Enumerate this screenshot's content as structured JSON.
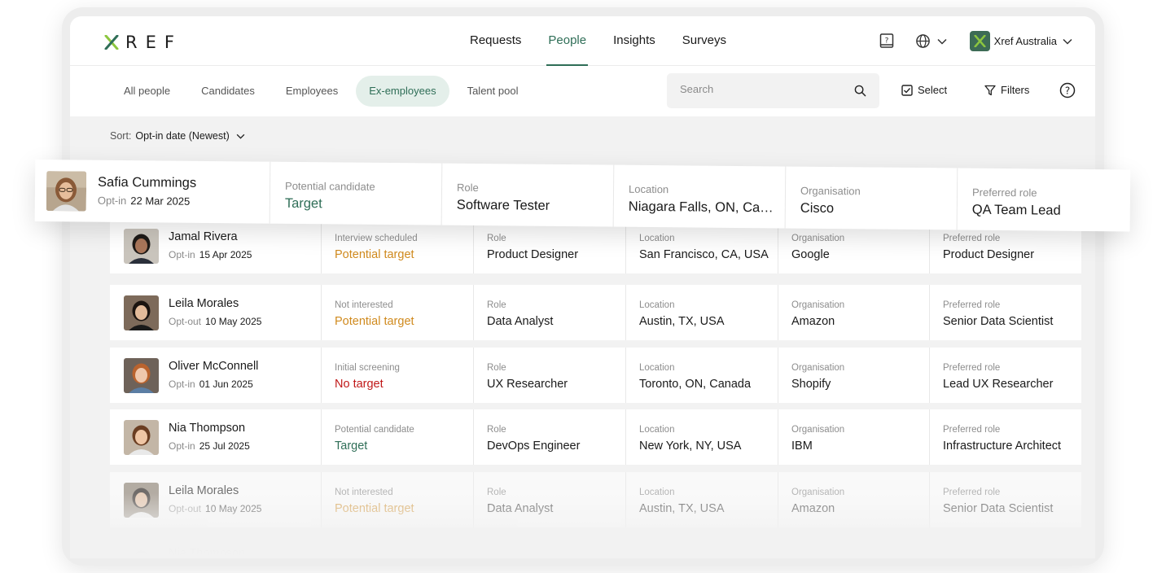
{
  "header": {
    "logo_text": "REF",
    "nav": [
      "Requests",
      "People",
      "Insights",
      "Surveys"
    ],
    "active_nav": "People",
    "org_name": "Xref Australia"
  },
  "subnav": {
    "tabs": [
      "All people",
      "Candidates",
      "Employees",
      "Ex-employees",
      "Talent pool"
    ],
    "active_tab": "Ex-employees",
    "search_placeholder": "Search",
    "select_label": "Select",
    "filters_label": "Filters"
  },
  "sort": {
    "label": "Sort:",
    "value": "Opt-in date (Newest)"
  },
  "column_titles": {
    "role": "Role",
    "location": "Location",
    "organisation": "Organisation",
    "preferred_role": "Preferred role"
  },
  "highlighted": {
    "name": "Safia Cummings",
    "opt_label": "Opt-in",
    "date": "22 Mar 2025",
    "status_title": "Potential candidate",
    "status_value": "Target",
    "role": "Software Tester",
    "location": "Niagara Falls, ON, Can...",
    "organisation": "Cisco",
    "preferred_role": "QA Team Lead"
  },
  "people": [
    {
      "name": "Jamal Rivera",
      "opt_label": "Opt-in",
      "date": "15 Apr 2025",
      "status_title": "Interview scheduled",
      "status_value": "Potential target",
      "status_color": "#d08a1e",
      "role": "Product Designer",
      "location": "San Francisco, CA, USA",
      "organisation": "Google",
      "preferred_role": "Product Designer"
    },
    {
      "name": "Leila Morales",
      "opt_label": "Opt-out",
      "date": "10 May 2025",
      "status_title": "Not interested",
      "status_value": "Potential target",
      "status_color": "#d08a1e",
      "role": "Data Analyst",
      "location": "Austin, TX, USA",
      "organisation": "Amazon",
      "preferred_role": "Senior Data Scientist"
    },
    {
      "name": "Oliver McConnell",
      "opt_label": "Opt-in",
      "date": "01 Jun 2025",
      "status_title": "Initial screening",
      "status_value": "No target",
      "status_color": "#c01818",
      "role": "UX Researcher",
      "location": "Toronto, ON, Canada",
      "organisation": "Shopify",
      "preferred_role": "Lead UX Researcher"
    },
    {
      "name": "Nia Thompson",
      "opt_label": "Opt-in",
      "date": "25 Jul 2025",
      "status_title": "Potential candidate",
      "status_value": "Target",
      "status_color": "#2f6e57",
      "role": "DevOps Engineer",
      "location": "New York, NY, USA",
      "organisation": "IBM",
      "preferred_role": "Infrastructure Architect"
    },
    {
      "name": "Leila Morales",
      "opt_label": "Opt-out",
      "date": "10 May 2025",
      "status_title": "Not interested",
      "status_value": "Potential target",
      "status_color": "#d08a1e",
      "role": "Data Analyst",
      "location": "Austin, TX, USA",
      "organisation": "Amazon",
      "preferred_role": "Senior Data Scientist"
    },
    {
      "name": "Nia Thompson",
      "opt_label": "",
      "date": "",
      "status_title": "",
      "status_value": "",
      "status_color": "#2f6e57",
      "role": "",
      "location": "",
      "organisation": "",
      "preferred_role": ""
    }
  ],
  "icons": [
    "x-logo-icon",
    "help-book-icon",
    "globe-icon",
    "chevron-down-icon",
    "search-icon",
    "checkbox-icon",
    "filter-icon",
    "question-circle-icon"
  ],
  "colors": {
    "accent": "#2f6e57",
    "warning": "#d08a1e",
    "danger": "#c01818",
    "brand_lime": "#8cc63f"
  }
}
